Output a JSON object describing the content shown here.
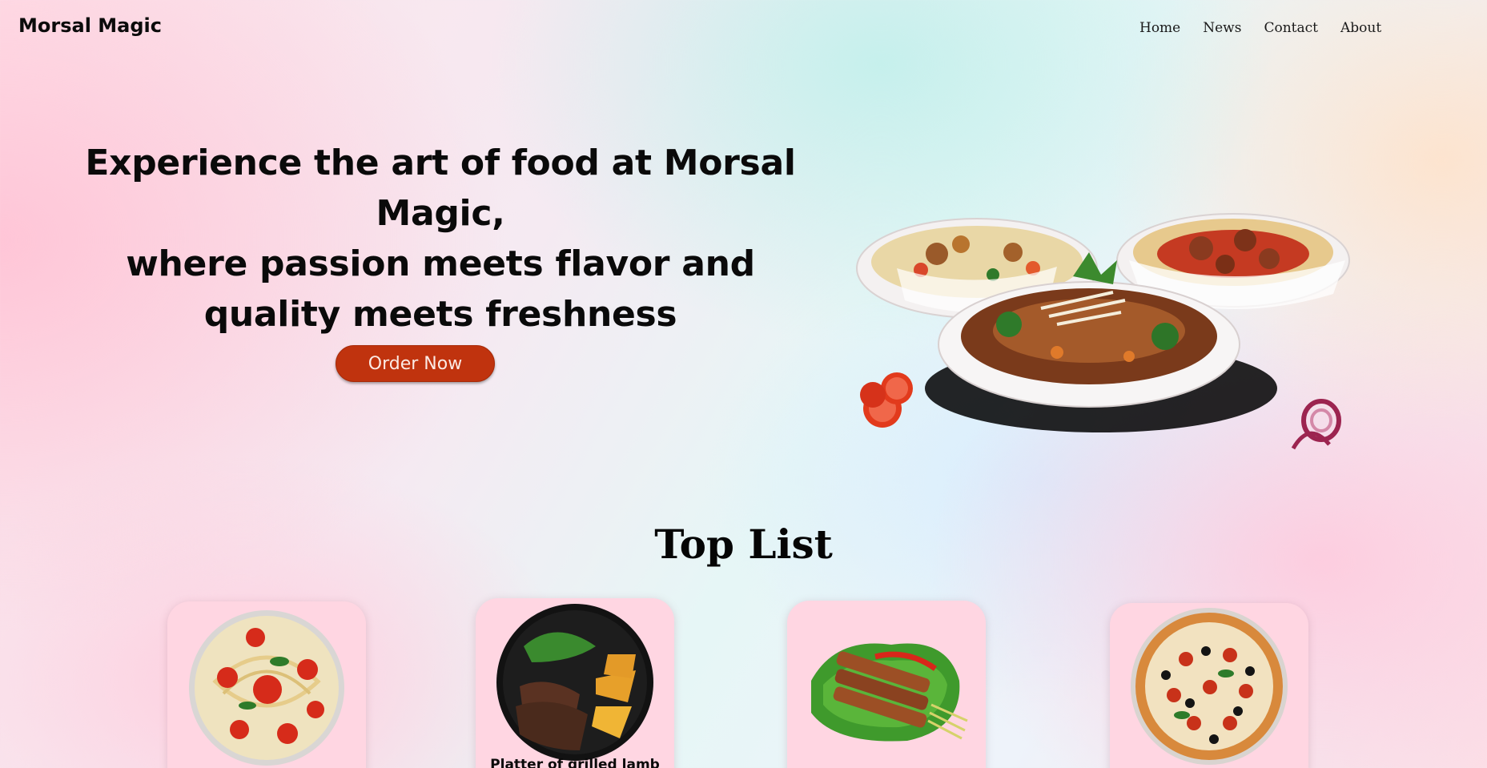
{
  "brand": "Morsal Magic",
  "nav": {
    "items": [
      "Home",
      "News",
      "Contact",
      "About"
    ]
  },
  "hero": {
    "title_lines": [
      "Experience the art of food at Morsal Magic,",
      "where passion meets flavor and",
      "quality meets freshness"
    ],
    "cta_label": "Order Now"
  },
  "top_list": {
    "title": "Top List",
    "items": [
      {
        "caption": ""
      },
      {
        "caption": "Platter of grilled lamb"
      },
      {
        "caption": ""
      },
      {
        "caption": ""
      }
    ]
  },
  "colors": {
    "accent": "#c0330e",
    "card_bg": "#ffd6e2"
  }
}
